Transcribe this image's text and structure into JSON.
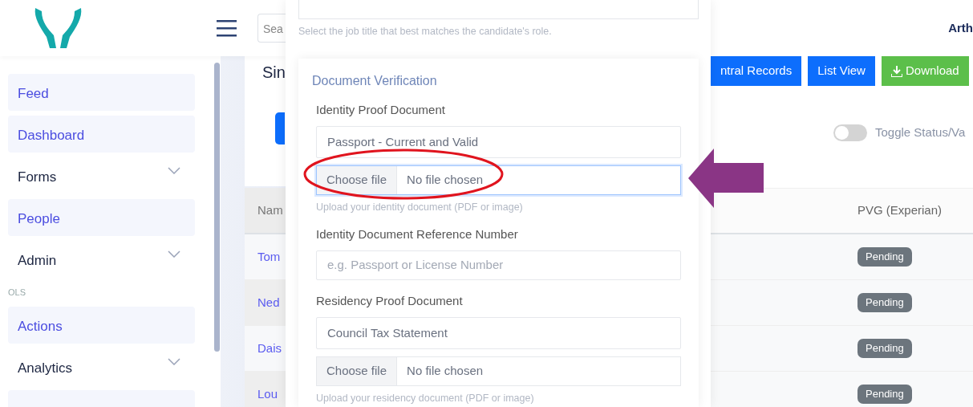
{
  "header": {
    "search": {
      "placeholder": "Sea"
    },
    "user": "Arth"
  },
  "sidebar": {
    "items": [
      {
        "kind": "link",
        "label": "Feed"
      },
      {
        "kind": "link",
        "label": "Dashboard"
      },
      {
        "kind": "group",
        "label": "Forms",
        "expanded": false
      },
      {
        "kind": "link",
        "label": "People"
      },
      {
        "kind": "group",
        "label": "Admin",
        "expanded": false
      },
      {
        "kind": "section",
        "label": "OLS"
      },
      {
        "kind": "link",
        "label": "Actions"
      },
      {
        "kind": "group",
        "label": "Analytics",
        "expanded": false
      },
      {
        "kind": "link"
      }
    ]
  },
  "page": {
    "title": "Sin",
    "buttons": [
      {
        "label": "ntral Records",
        "kind": "nav"
      },
      {
        "label": "List View",
        "kind": "nav"
      },
      {
        "label": "Download",
        "kind": "download"
      }
    ],
    "toggle": {
      "label": "Toggle Status/Va",
      "on": false
    },
    "table": {
      "columns": [
        "Nam",
        "PVG (Experian)"
      ],
      "rows": [
        {
          "name": "Tom",
          "status": "Pending"
        },
        {
          "name": "Ned",
          "status": "Pending"
        },
        {
          "name": "Dais",
          "status": "Pending"
        },
        {
          "name": "Lou",
          "status": "Pending"
        }
      ]
    }
  },
  "modal": {
    "job_title_hint": "Select the job title that best matches the candidate's role.",
    "section_title": "Document Verification",
    "groups": [
      {
        "label": "Identity Proof Document",
        "controls": [
          {
            "kind": "select",
            "value": "Passport - Current and Valid"
          },
          {
            "kind": "file",
            "button": "Choose file",
            "status": "No file chosen",
            "focused": true
          }
        ],
        "hint": "Upload your identity document (PDF or image)"
      },
      {
        "label": "Identity Document Reference Number",
        "controls": [
          {
            "kind": "text",
            "placeholder": "e.g. Passport or License Number"
          }
        ]
      },
      {
        "label": "Residency Proof Document",
        "controls": [
          {
            "kind": "select",
            "value": "Council Tax Statement"
          },
          {
            "kind": "file",
            "button": "Choose file",
            "status": "No file chosen",
            "focused": false
          }
        ],
        "hint": "Upload your residency document (PDF or image)"
      }
    ]
  },
  "annotations": {
    "ellipse": true,
    "arrow": true
  }
}
